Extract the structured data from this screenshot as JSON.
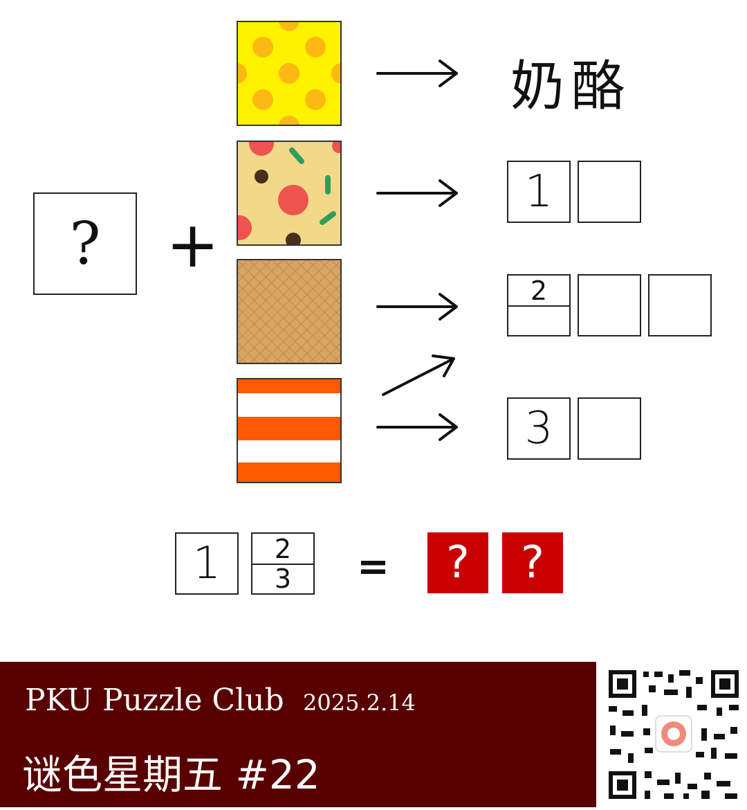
{
  "puzzle": {
    "unknown_symbol": "?",
    "plus_sign": "+",
    "equals_sign": "=",
    "cheese_text": "奶酪",
    "row1_first_digit": "1",
    "row2_top_digit": "2",
    "row3_first_digit": "3",
    "equation": {
      "box1": "1",
      "box2_top": "2",
      "box2_bottom": "3",
      "answer1": "?",
      "answer2": "?"
    }
  },
  "footer": {
    "club_name": "PKU Puzzle Club",
    "date": "2025.2.14",
    "series_title": "谜色星期五 #22"
  },
  "colors": {
    "answer_red": "#c90000",
    "footer_bg": "#580000",
    "cheese_yellow": "#fff200",
    "stripe_orange": "#ff5a00"
  },
  "icons": {
    "pattern1": "yellow-polka-dot-cheese-pattern",
    "pattern2": "pizza-topping-pattern",
    "pattern3": "waffle-cone-pattern",
    "pattern4": "orange-white-stripe-pattern",
    "qr": "qr-code-icon"
  }
}
